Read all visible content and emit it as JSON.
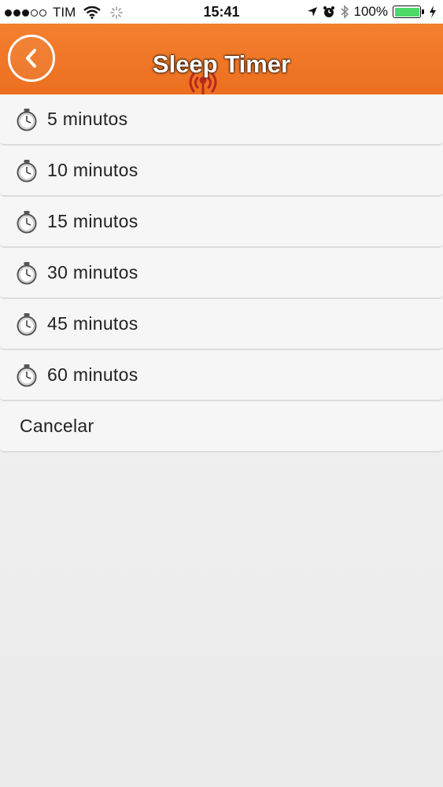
{
  "status_bar": {
    "carrier": "TIM",
    "time": "15:41",
    "battery": "100%"
  },
  "header": {
    "title": "Sleep Timer",
    "back_icon": "chevron-left-icon",
    "accent_color": "#f07a2a"
  },
  "options": [
    {
      "label": "5 minutos",
      "icon": "stopwatch-icon"
    },
    {
      "label": "10 minutos",
      "icon": "stopwatch-icon"
    },
    {
      "label": "15 minutos",
      "icon": "stopwatch-icon"
    },
    {
      "label": "30 minutos",
      "icon": "stopwatch-icon"
    },
    {
      "label": "45 minutos",
      "icon": "stopwatch-icon"
    },
    {
      "label": "60 minutos",
      "icon": "stopwatch-icon"
    }
  ],
  "cancel_label": "Cancelar"
}
